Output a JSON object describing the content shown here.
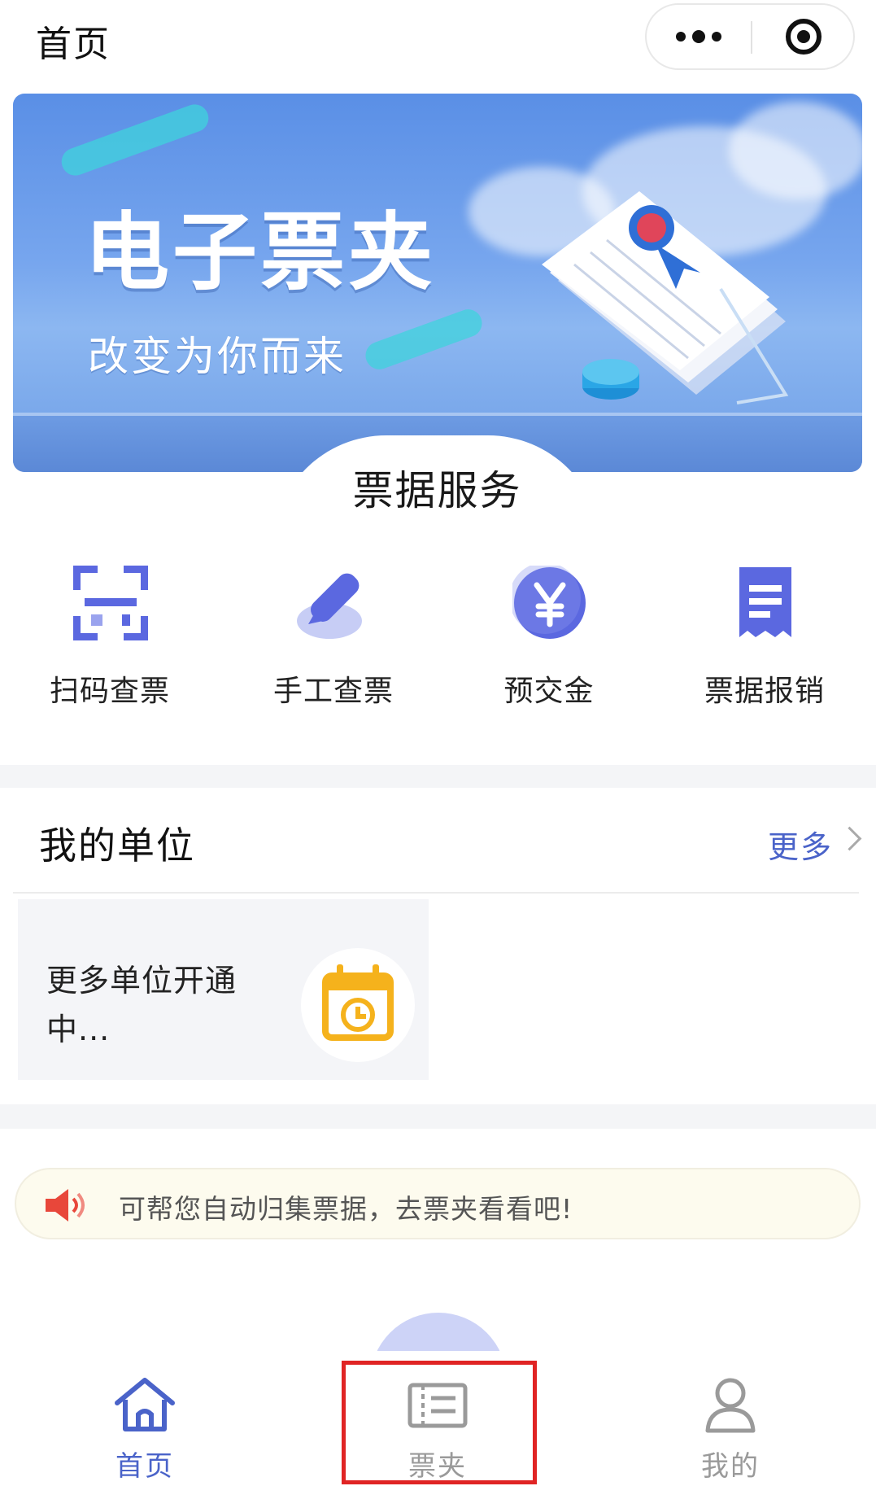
{
  "header": {
    "title": "首页"
  },
  "banner": {
    "title": "电子票夹",
    "subtitle": "改变为你而来"
  },
  "services": {
    "heading": "票据服务",
    "items": [
      {
        "label": "扫码查票",
        "icon": "scan-icon"
      },
      {
        "label": "手工查票",
        "icon": "pen-icon"
      },
      {
        "label": "预交金",
        "icon": "yuan-coin-icon"
      },
      {
        "label": "票据报销",
        "icon": "receipt-icon"
      }
    ]
  },
  "units": {
    "title": "我的单位",
    "more_label": "更多",
    "card_text": "更多单位开通中..."
  },
  "notice": {
    "text": "可帮您自动归集票据，去票夹看看吧!"
  },
  "tabbar": {
    "items": [
      {
        "label": "首页",
        "icon": "home-icon",
        "active": true
      },
      {
        "label": "票夹",
        "icon": "ticket-folder-icon",
        "active": false
      },
      {
        "label": "我的",
        "icon": "user-icon",
        "active": false
      }
    ]
  },
  "colors": {
    "accent": "#4a63c9",
    "inactive": "#9a9a9a",
    "highlight": "#e02424",
    "calendar": "#f5b21c",
    "speaker": "#e8473a"
  }
}
